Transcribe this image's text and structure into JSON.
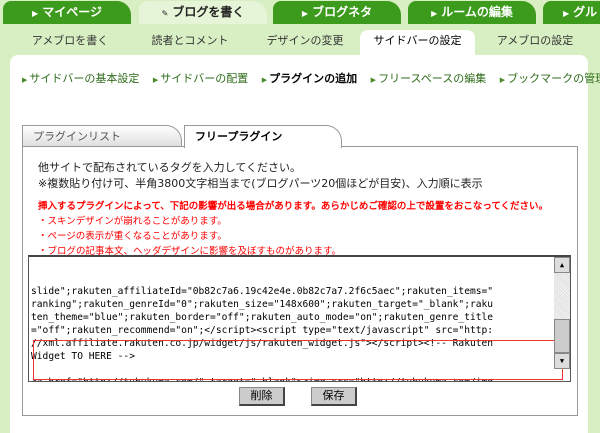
{
  "top_tabs": [
    {
      "label": "マイページ"
    },
    {
      "label": "ブログを書く",
      "active": true
    },
    {
      "label": "ブログネタ"
    },
    {
      "label": "ルームの編集"
    },
    {
      "label": "グル"
    }
  ],
  "sub_tabs": [
    {
      "label": "アメブロを書く"
    },
    {
      "label": "読者とコメント"
    },
    {
      "label": "デザインの変更"
    },
    {
      "label": "サイドバーの設定",
      "active": true
    },
    {
      "label": "アメブロの設定"
    }
  ],
  "links": [
    "サイドバーの基本設定",
    "サイドバーの配置",
    "プラグインの追加",
    "フリースペースの編集",
    "ブックマークの管理"
  ],
  "plugin_tabs": [
    "プラグインリスト",
    "フリープラグイン"
  ],
  "desc": [
    "他サイトで配布されているタグを入力してください。",
    "※複数貼り付け可、半角3800文字相当まで(ブログパーツ20個ほどが目安)、入力順に表示"
  ],
  "warning": {
    "heading": "挿入するプラグインによって、下記の影響が出る場合があります。あらかじめご確認の上で設置をおこなってください。",
    "items": [
      "・スキンデザインが崩れることがあります。",
      "・ページの表示が重くなることがあります。",
      "・ブログの記事本文、ヘッダデザインに影響を及ぼすものがあります。"
    ]
  },
  "textarea_value": "slide\";rakuten_affiliateId=\"0b82c7a6.19c42e4e.0b82c7a7.2f6c5aec\";rakuten_items=\"\nranking\";rakuten_genreId=\"0\";rakuten_size=\"148x600\";rakuten_target=\"_blank\";raku\nten_theme=\"blue\";rakuten_border=\"off\";rakuten_auto_mode=\"on\";rakuten_genre_title\n=\"off\";rakuten_recommend=\"on\";</script><script type=\"text/javascript\" src=\"http:\n//xml.affiliate.rakuten.co.jp/widget/js/rakuten_widget.js\"></script><!-- Rakuten\nWidget TO HERE -->\n\n<a href=\"http://tubukuma.com/\" target=\"_blank\"><img src=\"http://tubukuma.com/img\n/tubukuma_mb.gif\" alt=\"熊谷ツイッターポータルサイト「つぶくま」\" width=\"88\" heig\nht=\"31\" border=\"0\" /></a>",
  "buttons": {
    "delete": "削除",
    "save": "保存"
  }
}
